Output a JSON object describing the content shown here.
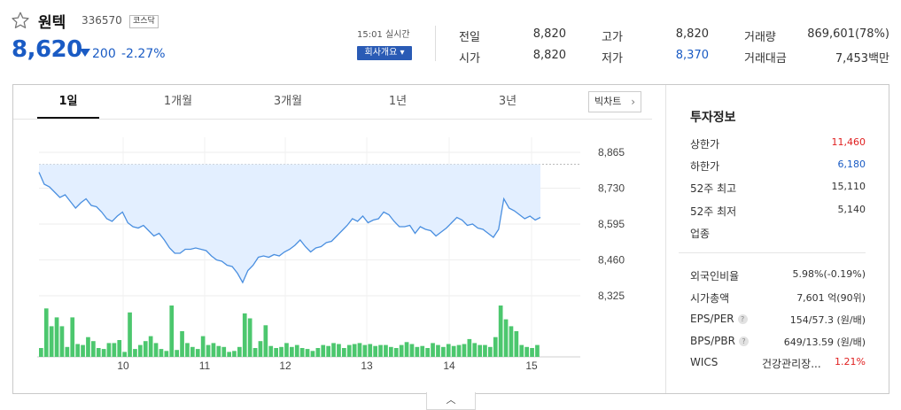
{
  "header": {
    "name": "원텍",
    "code": "336570",
    "market": "코스닥",
    "price": "8,620",
    "change": "200",
    "change_pct": "-2.27%",
    "realtime": "15:01 실시간",
    "company_button": "회사개요 ▾",
    "quotes": [
      {
        "label": "전일",
        "value": "8,820"
      },
      {
        "label": "시가",
        "value": "8,820"
      },
      {
        "label": "고가",
        "value": "8,820"
      },
      {
        "label": "저가",
        "value": "8,370"
      },
      {
        "label": "거래량",
        "value": "869,601(78%)"
      },
      {
        "label": "거래대금",
        "value": "7,453백만"
      }
    ]
  },
  "tabs": [
    {
      "label": "1일"
    },
    {
      "label": "1개월"
    },
    {
      "label": "3개월"
    },
    {
      "label": "1년"
    },
    {
      "label": "3년"
    }
  ],
  "bigchart_label": "빅차트",
  "chart_data": {
    "type": "line",
    "y_ticks": [
      "8,865",
      "8,730",
      "8,595",
      "8,460",
      "8,325"
    ],
    "ylim": [
      8325,
      8865
    ],
    "reference_price": 8820,
    "x_ticks": [
      "10",
      "11",
      "12",
      "13",
      "14",
      "15"
    ],
    "price_series": [
      8790,
      8745,
      8735,
      8715,
      8695,
      8705,
      8680,
      8655,
      8675,
      8690,
      8665,
      8660,
      8640,
      8615,
      8605,
      8625,
      8640,
      8600,
      8585,
      8580,
      8590,
      8570,
      8550,
      8560,
      8535,
      8505,
      8485,
      8485,
      8500,
      8500,
      8505,
      8500,
      8495,
      8475,
      8460,
      8455,
      8440,
      8435,
      8410,
      8375,
      8420,
      8440,
      8470,
      8475,
      8470,
      8480,
      8475,
      8490,
      8500,
      8515,
      8535,
      8510,
      8490,
      8505,
      8510,
      8525,
      8530,
      8550,
      8570,
      8590,
      8615,
      8605,
      8625,
      8600,
      8610,
      8615,
      8640,
      8630,
      8605,
      8585,
      8585,
      8590,
      8560,
      8585,
      8575,
      8570,
      8550,
      8565,
      8580,
      8600,
      8620,
      8610,
      8590,
      8595,
      8580,
      8575,
      8560,
      8545,
      8575,
      8690,
      8655,
      8645,
      8630,
      8615,
      8625,
      8610,
      8620
    ],
    "volume_series": [
      9,
      49,
      31,
      40,
      31,
      10,
      40,
      13,
      12,
      20,
      16,
      9,
      8,
      14,
      14,
      17,
      5,
      45,
      8,
      12,
      16,
      21,
      14,
      8,
      6,
      52,
      7,
      26,
      14,
      10,
      8,
      21,
      12,
      14,
      11,
      10,
      5,
      6,
      10,
      44,
      39,
      9,
      16,
      32,
      11,
      9,
      10,
      14,
      10,
      12,
      9,
      8,
      6,
      9,
      12,
      11,
      14,
      13,
      9,
      12,
      13,
      14,
      12,
      13,
      11,
      12,
      12,
      10,
      9,
      12,
      15,
      13,
      10,
      11,
      9,
      14,
      12,
      10,
      13,
      11,
      12,
      13,
      18,
      14,
      12,
      12,
      10,
      20,
      52,
      38,
      31,
      26,
      12,
      10,
      9,
      12
    ]
  },
  "info": {
    "title": "투자정보",
    "rows1": [
      {
        "label": "상한가",
        "value": "11,460",
        "color": "#e02020"
      },
      {
        "label": "하한가",
        "value": "6,180",
        "color": "#1a5bc4"
      },
      {
        "label": "52주 최고",
        "value": "15,110"
      },
      {
        "label": "52주 최저",
        "value": "5,140"
      },
      {
        "label": "업종",
        "value": ""
      }
    ],
    "rows2": [
      {
        "label": "외국인비율",
        "value": "5.98%(-0.19%)"
      },
      {
        "label": "시가총액",
        "value": "7,601 억(90위)"
      },
      {
        "label": "EPS/PER",
        "value": "154/57.3 (원/배)",
        "help": true
      },
      {
        "label": "BPS/PBR",
        "value": "649/13.59 (원/배)",
        "help": true
      }
    ],
    "wics_label": "WICS",
    "wics_name": "건강관리장...",
    "wics_pct": "1.21%"
  },
  "collapse_icon": "chevron-up-icon"
}
